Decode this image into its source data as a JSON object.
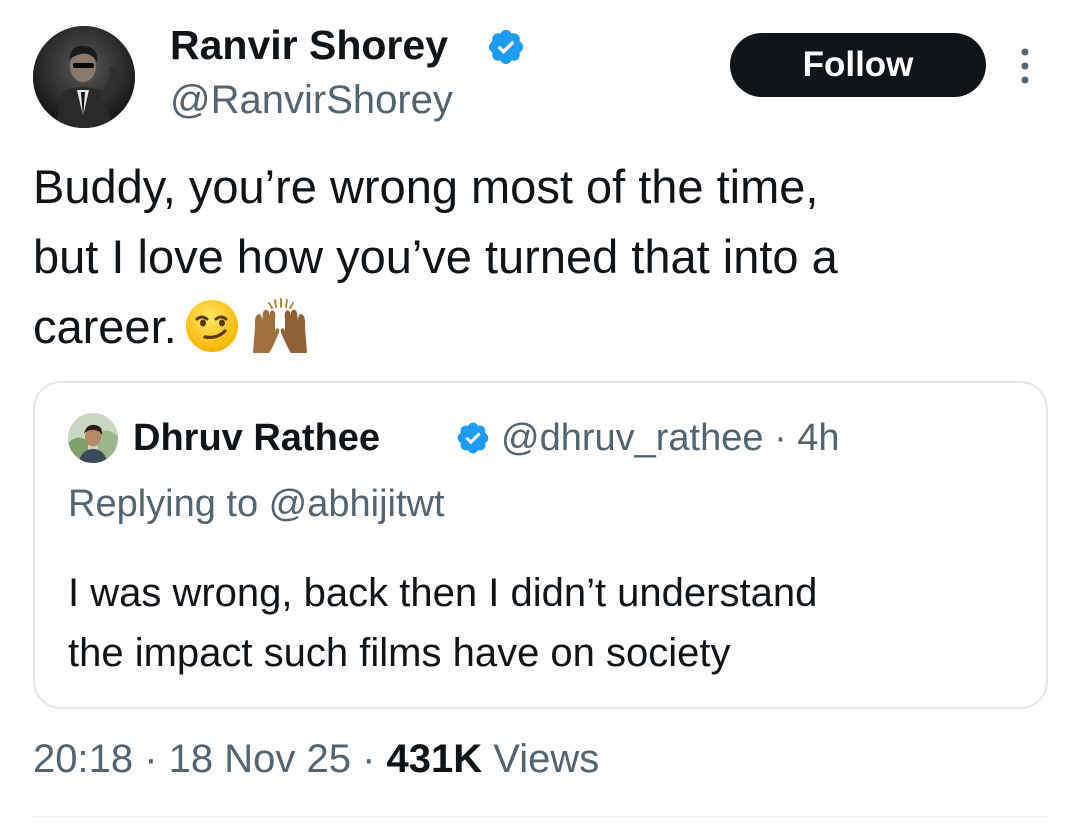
{
  "author": {
    "display_name": "Ranvir Shorey",
    "handle": "@RanvirShorey",
    "avatar_icon": "profile-photo",
    "verified_icon": "verified-badge-icon"
  },
  "actions": {
    "follow_label": "Follow",
    "more_icon": "more-options-icon"
  },
  "tweet": {
    "line1": "Buddy, you’re wrong most of the time,",
    "line2": "but I love how you’ve turned that into a",
    "line3": "career.",
    "emojis": [
      "smirking-face",
      "raising-hands-medium-dark"
    ]
  },
  "quote": {
    "display_name": "Dhruv Rathee",
    "handle_time": "@dhruv_rathee · 4h",
    "replying_to": "Replying to @abhijitwt",
    "line1": "I was wrong, back then I didn’t understand",
    "line2": "the impact such films have on society"
  },
  "meta": {
    "time_date": "20:18 · 18 Nov 25 · ",
    "views_count": "431K",
    "views_label": " Views"
  },
  "colors": {
    "primary_text": "#0f1419",
    "secondary_text": "#536471",
    "verified_blue": "#1d9bf0",
    "follow_button": "#0f1419",
    "card_border": "#e1e6ea"
  }
}
